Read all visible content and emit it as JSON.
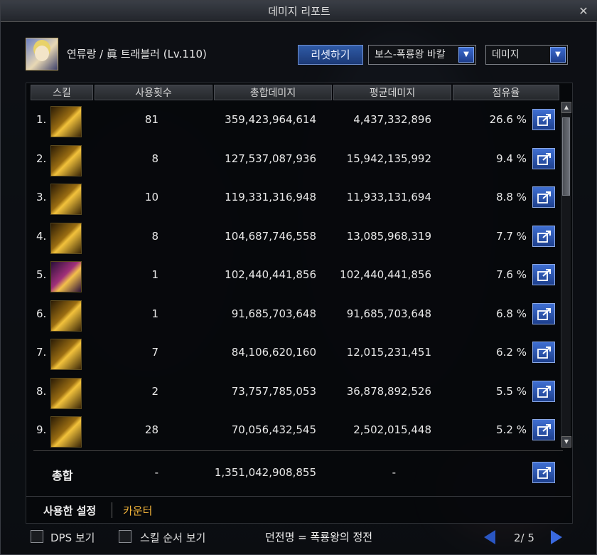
{
  "window": {
    "title": "데미지 리포트"
  },
  "header": {
    "character": "연류랑 / 眞 트래블러 (Lv.110)",
    "reset_label": "리셋하기",
    "target_select": "보스-폭룡왕 바칼",
    "mode_select": "데미지"
  },
  "table": {
    "columns": [
      "스킬",
      "사용횟수",
      "총합데미지",
      "평균데미지",
      "점유율"
    ],
    "rows": [
      {
        "rank": "1.",
        "icon": "skill-gold-icon",
        "count": "81",
        "total": "359,423,964,614",
        "avg": "4,437,332,896",
        "share": "26.6 %"
      },
      {
        "rank": "2.",
        "icon": "skill-gold-icon",
        "count": "8",
        "total": "127,537,087,936",
        "avg": "15,942,135,992",
        "share": "9.4 %"
      },
      {
        "rank": "3.",
        "icon": "skill-gold-icon",
        "count": "10",
        "total": "119,331,316,948",
        "avg": "11,933,131,694",
        "share": "8.8 %"
      },
      {
        "rank": "4.",
        "icon": "skill-gold-icon",
        "count": "8",
        "total": "104,687,746,558",
        "avg": "13,085,968,319",
        "share": "7.7 %"
      },
      {
        "rank": "5.",
        "icon": "skill-purple-icon",
        "count": "1",
        "total": "102,440,441,856",
        "avg": "102,440,441,856",
        "share": "7.6 %"
      },
      {
        "rank": "6.",
        "icon": "skill-gold-icon",
        "count": "1",
        "total": "91,685,703,648",
        "avg": "91,685,703,648",
        "share": "6.8 %"
      },
      {
        "rank": "7.",
        "icon": "skill-gold-icon",
        "count": "7",
        "total": "84,106,620,160",
        "avg": "12,015,231,451",
        "share": "6.2 %"
      },
      {
        "rank": "8.",
        "icon": "skill-gold-icon",
        "count": "2",
        "total": "73,757,785,053",
        "avg": "36,878,892,526",
        "share": "5.5 %"
      },
      {
        "rank": "9.",
        "icon": "skill-gold-icon",
        "count": "28",
        "total": "70,056,432,545",
        "avg": "2,502,015,448",
        "share": "5.2 %"
      }
    ],
    "total": {
      "label": "총합",
      "count": "-",
      "total": "1,351,042,908,855",
      "avg": "-"
    }
  },
  "tabs": {
    "settings": "사용한 설정",
    "counter": "카운터"
  },
  "bottom": {
    "dps_label": "DPS 보기",
    "order_label": "스킬 순서 보기",
    "dungeon": "던전명 = 폭룡왕의 정전",
    "page": "2/ 5"
  },
  "colors": {
    "accent": "#2f5aa6",
    "tab_highlight": "#f2b43a"
  }
}
